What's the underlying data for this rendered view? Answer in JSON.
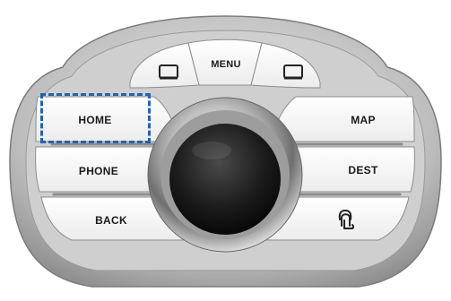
{
  "buttons": {
    "menu": "MENU",
    "home": "HOME",
    "map": "MAP",
    "phone": "PHONE",
    "dest": "DEST",
    "back": "BACK"
  },
  "icons": {
    "left_softkey": "rectangle-key-icon",
    "right_softkey": "rectangle-key-icon",
    "custom": "finger-press-icon"
  },
  "highlight": {
    "target": "HOME",
    "color": "#1f63b6"
  }
}
